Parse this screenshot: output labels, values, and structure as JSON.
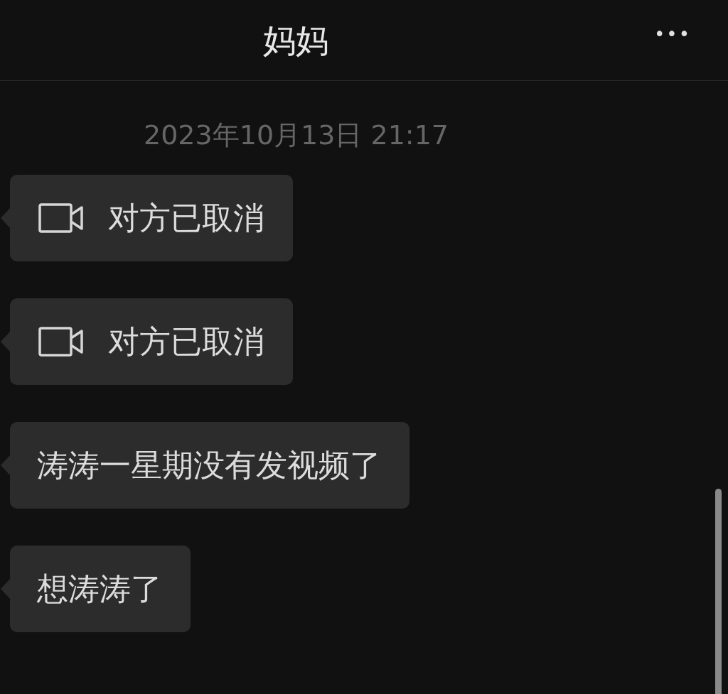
{
  "header": {
    "title": "妈妈",
    "more": "•••"
  },
  "timestamp": "2023年10月13日 21:17",
  "messages": [
    {
      "kind": "video_call",
      "text": "对方已取消"
    },
    {
      "kind": "video_call",
      "text": "对方已取消"
    },
    {
      "kind": "text",
      "text": "涛涛一星期没有发视频了"
    },
    {
      "kind": "text",
      "text": "想涛涛了"
    }
  ]
}
